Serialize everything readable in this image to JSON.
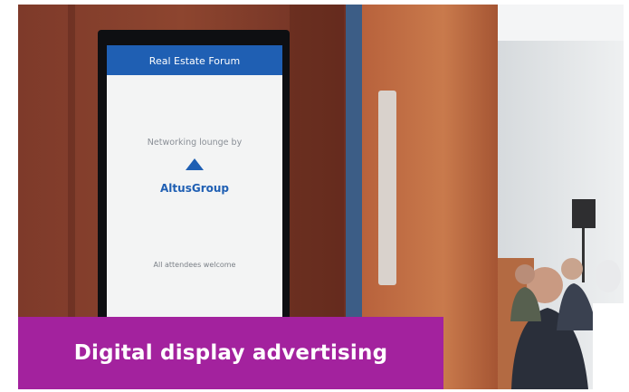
{
  "photo": {
    "screen_header": "Real Estate Forum",
    "screen_line1": "Networking lounge by",
    "screen_brand": "AltusGroup",
    "screen_footer": "All attendees welcome"
  },
  "caption": {
    "text": "Digital display advertising"
  },
  "colors": {
    "caption_bg": "#a3229e",
    "caption_text": "#ffffff",
    "screen_header_bg": "#1f5fb3"
  }
}
